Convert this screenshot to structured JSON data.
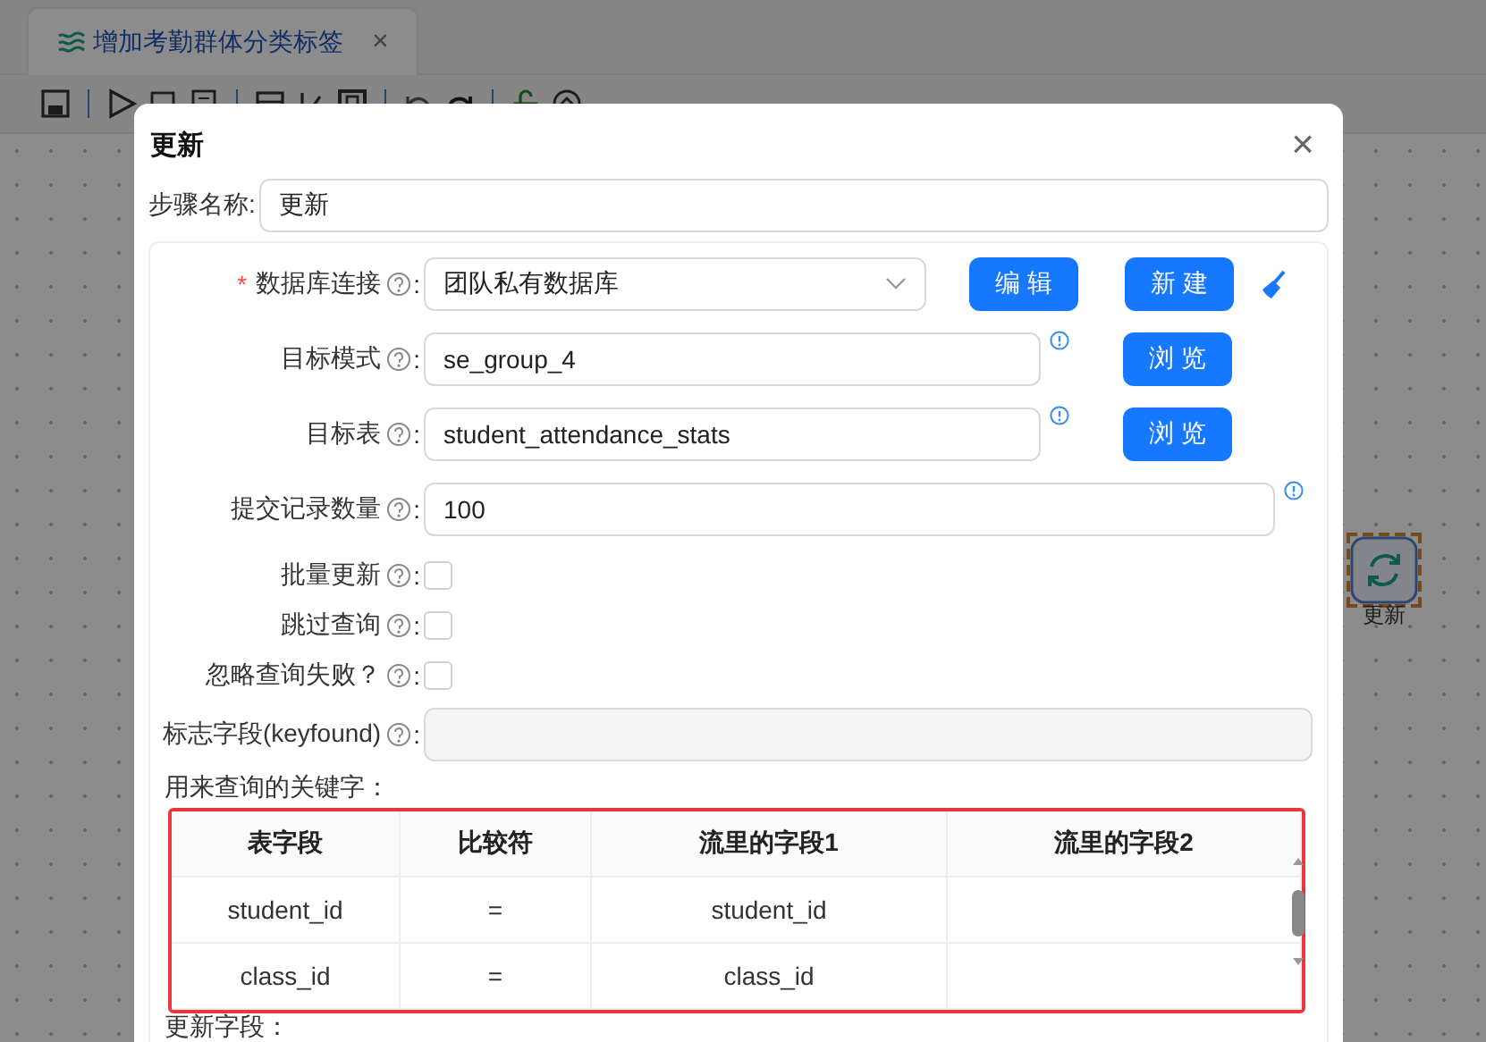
{
  "tab": {
    "title": "增加考勤群体分类标签",
    "close": "×",
    "selected": true
  },
  "dialog": {
    "title": "更新",
    "close": "×",
    "step_name": {
      "label": "步骤名称:",
      "value": "更新"
    },
    "fields": [
      {
        "kind": "select",
        "required_mark": "*",
        "label": "数据库连接",
        "colon": ":",
        "value": "团队私有数据库",
        "buttons": [
          "编 辑",
          "新 建"
        ]
      },
      {
        "kind": "input",
        "label": "目标模式",
        "colon": ":",
        "value": "se_group_4",
        "buttons": [
          "浏 览"
        ]
      },
      {
        "kind": "input",
        "label": "目标表",
        "colon": ":",
        "value": "student_attendance_stats",
        "buttons": [
          "浏 览"
        ]
      },
      {
        "kind": "wide",
        "label": "提交记录数量",
        "colon": ":",
        "value": "100"
      },
      {
        "kind": "checkbox",
        "label": "批量更新",
        "colon": ":",
        "checked": false
      },
      {
        "kind": "checkbox",
        "label": "跳过查询",
        "colon": ":",
        "checked": false
      },
      {
        "kind": "checkbox",
        "label": "忽略查询失败？",
        "colon": ":",
        "checked": false
      },
      {
        "kind": "disabled",
        "label": "标志字段(keyfound)",
        "colon": ":"
      }
    ],
    "keys_title": "用来查询的关键字：",
    "table": {
      "columns": [
        "表字段",
        "比较符",
        "流里的字段1",
        "流里的字段2"
      ],
      "rows": [
        [
          "student_id",
          "=",
          "student_id",
          null
        ],
        [
          "class_id",
          "=",
          "class_id",
          null
        ]
      ]
    },
    "next_title": "更新字段："
  },
  "canvas_node": {
    "label": "更新"
  }
}
